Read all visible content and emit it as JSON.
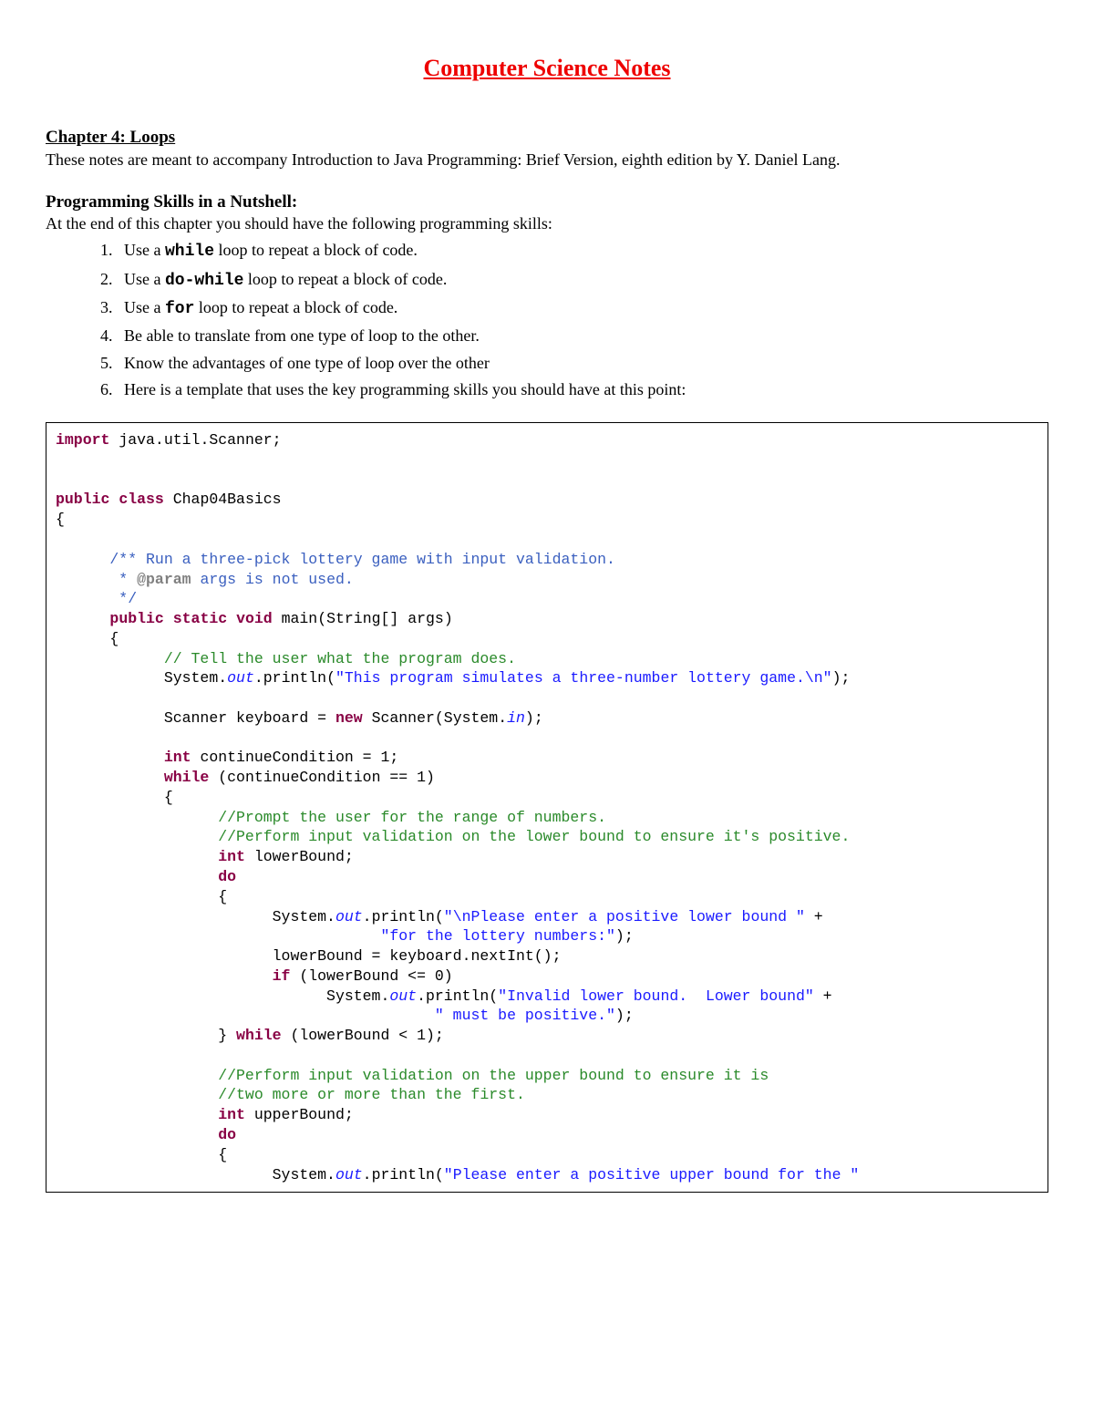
{
  "title": "Computer Science Notes",
  "chapter_heading": "Chapter 4: Loops",
  "intro": "These notes are meant to accompany Introduction to Java Programming: Brief Version, eighth edition by Y. Daniel Lang.",
  "section_heading": "Programming Skills in a Nutshell:",
  "section_intro": "At the end of this chapter you should have the following programming skills:",
  "skills": [
    {
      "pre": "Use a ",
      "kw": "while",
      "post": " loop to repeat a block of code."
    },
    {
      "pre": "Use a ",
      "kw": "do-while",
      "post": " loop to repeat a block of code."
    },
    {
      "pre": "Use a ",
      "kw": "for",
      "post": " loop to repeat a block of code."
    },
    {
      "pre": "Be able to translate from one type of loop to the other.",
      "kw": "",
      "post": ""
    },
    {
      "pre": "Know the advantages of one type of loop over the other",
      "kw": "",
      "post": ""
    },
    {
      "pre": "Here is a template that uses the key programming skills you should have at this point:",
      "kw": "",
      "post": ""
    }
  ],
  "code": {
    "l01_kw": "import",
    "l01_rest": " java.util.Scanner;",
    "l03_kw1": "public",
    "l03_kw2": "class",
    "l03_rest": " Chap04Basics",
    "l04": "{",
    "jdoc1": "      /** Run a three-pick lottery game with input validation.",
    "jdoc2a": "       * ",
    "jdoc2tag": "@param",
    "jdoc2b": " args is not used.",
    "jdoc3": "       */",
    "m_indent": "      ",
    "m_kw1": "public",
    "m_kw2": "static",
    "m_kw3": "void",
    "m_rest": " main(String[] args)",
    "m_open": "      {",
    "cm1": "            // Tell the user what the program does.",
    "p1a": "            System.",
    "p1out": "out",
    "p1b": ".println(",
    "p1s": "\"This program simulates a three-number lottery game.\\n\"",
    "p1c": ");",
    "sc_a": "            Scanner keyboard = ",
    "sc_kw": "new",
    "sc_b": " Scanner(System.",
    "sc_in": "in",
    "sc_c": ");",
    "cc_indent": "            ",
    "cc_kw": "int",
    "cc_rest": " continueCondition = 1;",
    "wh_indent": "            ",
    "wh_kw": "while",
    "wh_rest": " (continueCondition == 1)",
    "wh_open": "            {",
    "cm2": "                  //Prompt the user for the range of numbers.",
    "cm3": "                  //Perform input validation on the lower bound to ensure it's positive.",
    "lb_indent": "                  ",
    "lb_kw": "int",
    "lb_rest": " lowerBound;",
    "do1_indent": "                  ",
    "do1_kw": "do",
    "do1_open": "                  {",
    "p2a": "                        System.",
    "p2out": "out",
    "p2b": ".println(",
    "p2s1": "\"\\nPlease enter a positive lower bound \"",
    "p2c": " +",
    "p2d": "                                    ",
    "p2s2": "\"for the lottery numbers:\"",
    "p2e": ");",
    "lb2": "                        lowerBound = keyboard.nextInt();",
    "if1_indent": "                        ",
    "if1_kw": "if",
    "if1_rest": " (lowerBound <= 0)",
    "p3a": "                              System.",
    "p3out": "out",
    "p3b": ".println(",
    "p3s1": "\"Invalid lower bound.  Lower bound\"",
    "p3c": " +",
    "p3d": "                                          ",
    "p3s2": "\" must be positive.\"",
    "p3e": ");",
    "do1c_a": "                  } ",
    "do1c_kw": "while",
    "do1c_b": " (lowerBound < 1);",
    "cm4": "                  //Perform input validation on the upper bound to ensure it is",
    "cm5": "                  //two more or more than the first.",
    "ub_indent": "                  ",
    "ub_kw": "int",
    "ub_rest": " upperBound;",
    "do2_indent": "                  ",
    "do2_kw": "do",
    "do2_open": "                  {",
    "p4a": "                        System.",
    "p4out": "out",
    "p4b": ".println(",
    "p4s": "\"Please enter a positive upper bound for the \""
  }
}
